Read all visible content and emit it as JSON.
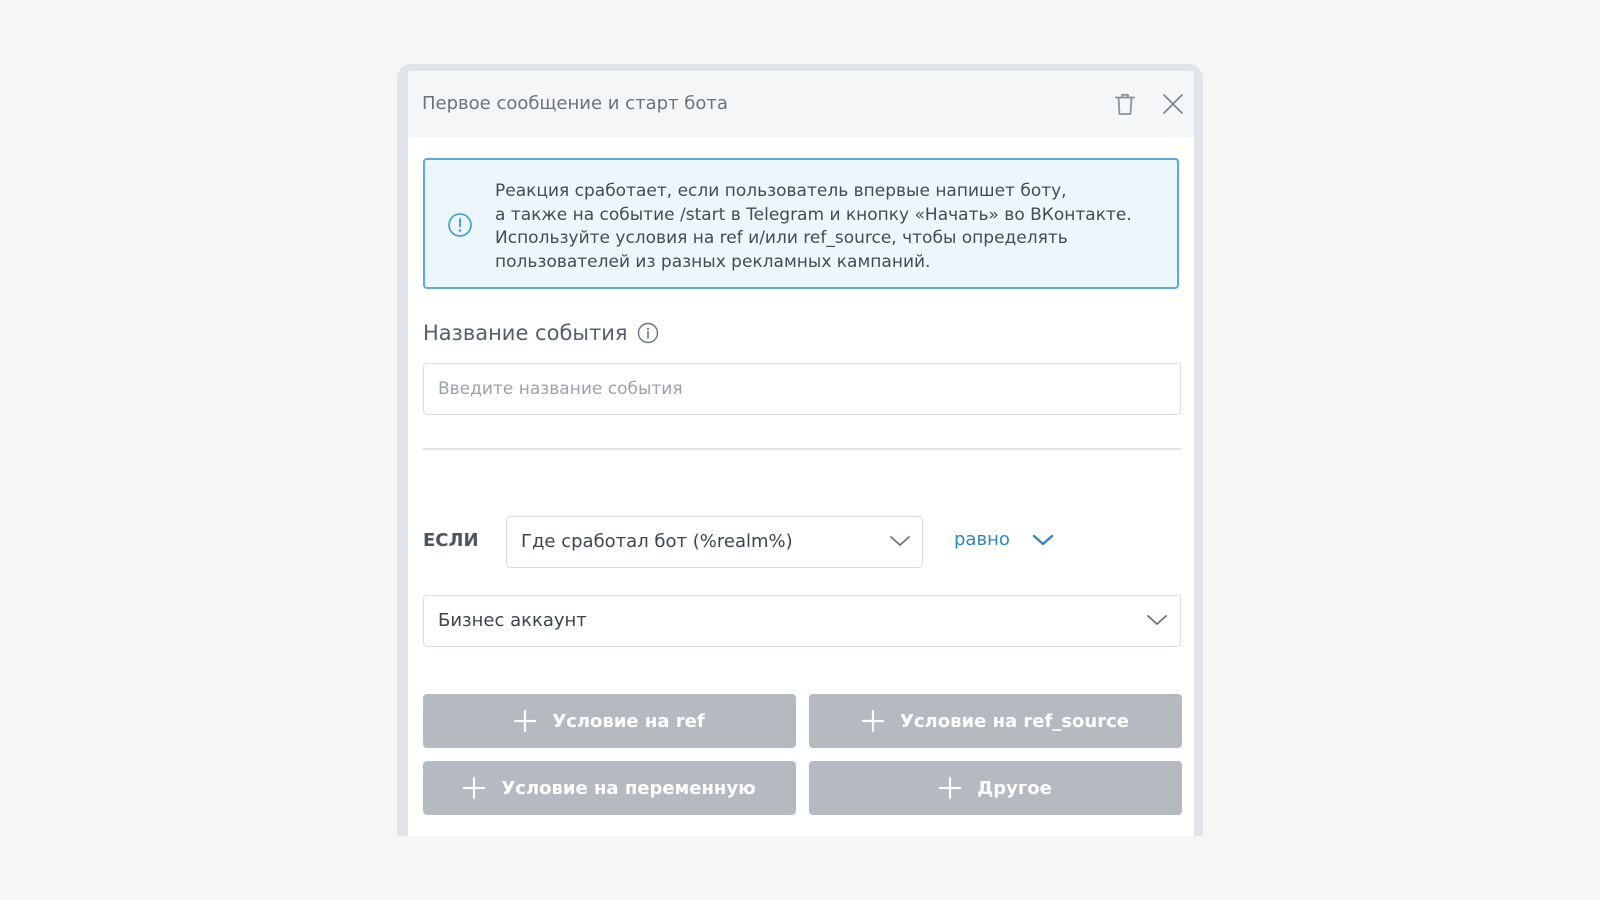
{
  "panel": {
    "title": "Первое сообщение и старт бота",
    "icons": {
      "delete": "trash-icon",
      "close": "close-icon"
    }
  },
  "info": {
    "icon": "exclamation-circle-icon",
    "lines": [
      "Реакция сработает, если пользователь впервые напишет боту,",
      "а также на событие /start в Telegram и кнопку «Начать» во ВКонтакте.",
      "Используйте условия на ref и/или ref_source, чтобы определять",
      "пользователей из разных рекламных кампаний."
    ]
  },
  "event_name": {
    "label": "Название события",
    "label_icon": "info-circle-icon",
    "value": "",
    "placeholder": "Введите название события"
  },
  "condition": {
    "if_label": "ЕСЛИ",
    "field_value": "Где сработал бот (%realm%)",
    "operator_value": "равно",
    "compare_value": "Бизнес аккаунт"
  },
  "buttons": {
    "ref": "Условие на ref",
    "ref_source": "Условие на ref_source",
    "variable": "Условие на переменную",
    "other": "Другое"
  },
  "colors": {
    "page_background": "#f6f6f7",
    "info_border": "#5aaadb",
    "info_background": "#eef6fd",
    "accent": "#2f85c9",
    "button_background": "#b5bac1"
  }
}
